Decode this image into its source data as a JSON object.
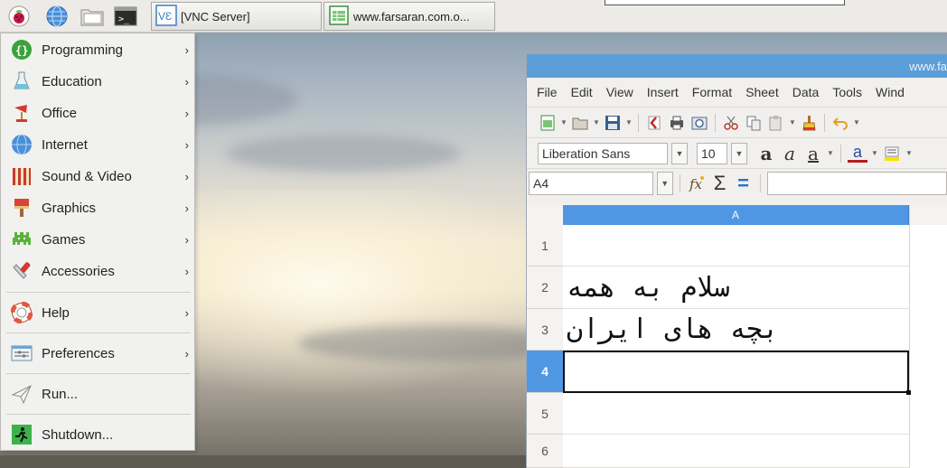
{
  "taskbar": {
    "vnc_label": "[VNC Server]",
    "calc_label": "www.farsaran.com.o..."
  },
  "menu": {
    "items": [
      {
        "label": "Programming",
        "icon": "programming-icon",
        "has_submenu": true
      },
      {
        "label": "Education",
        "icon": "education-icon",
        "has_submenu": true
      },
      {
        "label": "Office",
        "icon": "office-icon",
        "has_submenu": true
      },
      {
        "label": "Internet",
        "icon": "internet-icon",
        "has_submenu": true
      },
      {
        "label": "Sound & Video",
        "icon": "sound-video-icon",
        "has_submenu": true
      },
      {
        "label": "Graphics",
        "icon": "graphics-icon",
        "has_submenu": true
      },
      {
        "label": "Games",
        "icon": "games-icon",
        "has_submenu": true
      },
      {
        "label": "Accessories",
        "icon": "accessories-icon",
        "has_submenu": true
      },
      {
        "label": "Help",
        "icon": "help-icon",
        "has_submenu": true
      },
      {
        "label": "Preferences",
        "icon": "preferences-icon",
        "has_submenu": true
      },
      {
        "label": "Run...",
        "icon": "run-icon",
        "has_submenu": false
      },
      {
        "label": "Shutdown...",
        "icon": "shutdown-icon",
        "has_submenu": false
      }
    ],
    "arrow": "›"
  },
  "calc": {
    "title": "www.fa",
    "menus": [
      "File",
      "Edit",
      "View",
      "Insert",
      "Format",
      "Sheet",
      "Data",
      "Tools",
      "Wind"
    ],
    "font_name": "Liberation Sans",
    "font_size": "10",
    "name_box": "A4",
    "sigma": "Σ",
    "equals": "=",
    "column_a": "A",
    "rows": [
      {
        "num": "1",
        "a": ""
      },
      {
        "num": "2",
        "a": "سلام به همه"
      },
      {
        "num": "3",
        "a": "بچه های ایران"
      },
      {
        "num": "4",
        "a": ""
      },
      {
        "num": "5",
        "a": ""
      },
      {
        "num": "6",
        "a": ""
      }
    ]
  },
  "colors": {
    "accent_blue": "#5c9ed8",
    "column_header_selected": "#4f97e3"
  }
}
